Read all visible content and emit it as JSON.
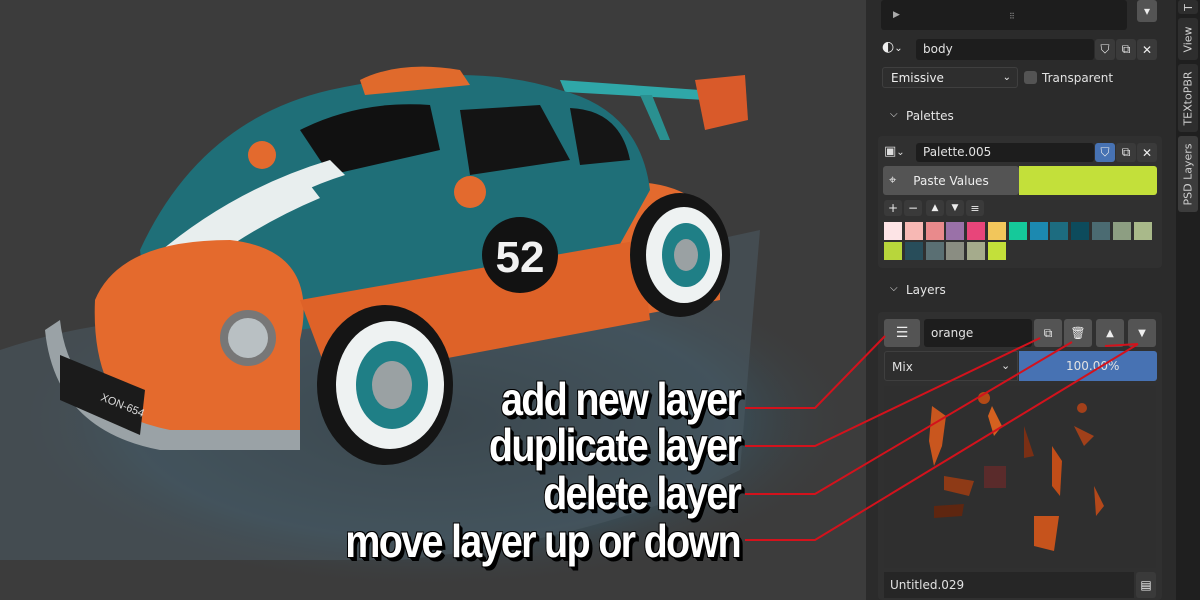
{
  "material": {
    "name": "body",
    "shader": "Emissive",
    "transparent_label": "Transparent"
  },
  "palettes": {
    "header": "Palettes",
    "palette_name": "Palette.005",
    "paste_label": "Paste Values",
    "active_color": "#c3e03a",
    "swatches_row1": [
      "#fde4e6",
      "#f7b8b4",
      "#e98a8c",
      "#9a71a8",
      "#e8457a",
      "#f2c65b",
      "#15c99a",
      "#1c89b0",
      "#1d6c80",
      "#0d4b5c",
      "#4b6b72",
      "#8d9e82",
      "#a9b98a"
    ],
    "swatches_row2": [
      "#b8d63b",
      "#284d5a",
      "#5a6f73",
      "#8a8d82",
      "#a5ab8c",
      "#c3e03a"
    ]
  },
  "layers": {
    "header": "Layers",
    "layer_name": "orange",
    "blend_mode": "Mix",
    "opacity": "100.00%",
    "image_name": "Untitled.029"
  },
  "tabs": [
    "T",
    "View",
    "TEXtoPBR",
    "PSD Layers"
  ],
  "annotations": [
    "add new layer",
    "duplicate layer",
    "delete layer",
    "move layer up or down"
  ],
  "colors": {
    "accent_blue": "#4772b3",
    "line_red": "#d3121c"
  }
}
